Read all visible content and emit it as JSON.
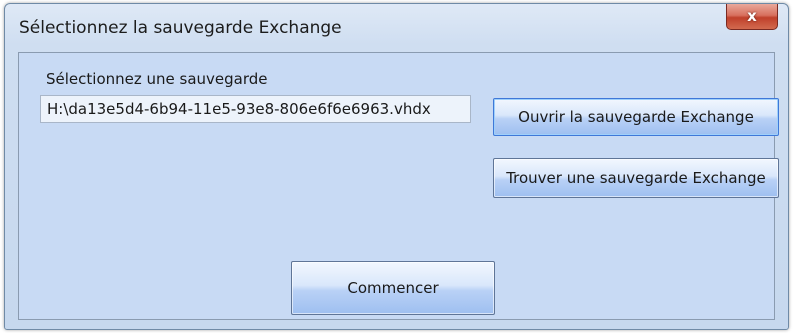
{
  "window": {
    "title": "Sélectionnez la sauvegarde Exchange",
    "close_glyph": "x"
  },
  "form": {
    "label": "Sélectionnez une sauvegarde",
    "path_value": "H:\\da13e5d4-6b94-11e5-93e8-806e6f6e6963.vhdx"
  },
  "buttons": {
    "open_label": "Ouvrir la sauvegarde Exchange",
    "find_label": "Trouver une sauvegarde Exchange",
    "start_label": "Commencer"
  },
  "icons": {
    "close": "close-icon"
  },
  "colors": {
    "frame": "#dfe9f6",
    "client_background": "#c8daf4",
    "close_button": "#c0402b",
    "button_gradient_end": "#9ebff0"
  }
}
